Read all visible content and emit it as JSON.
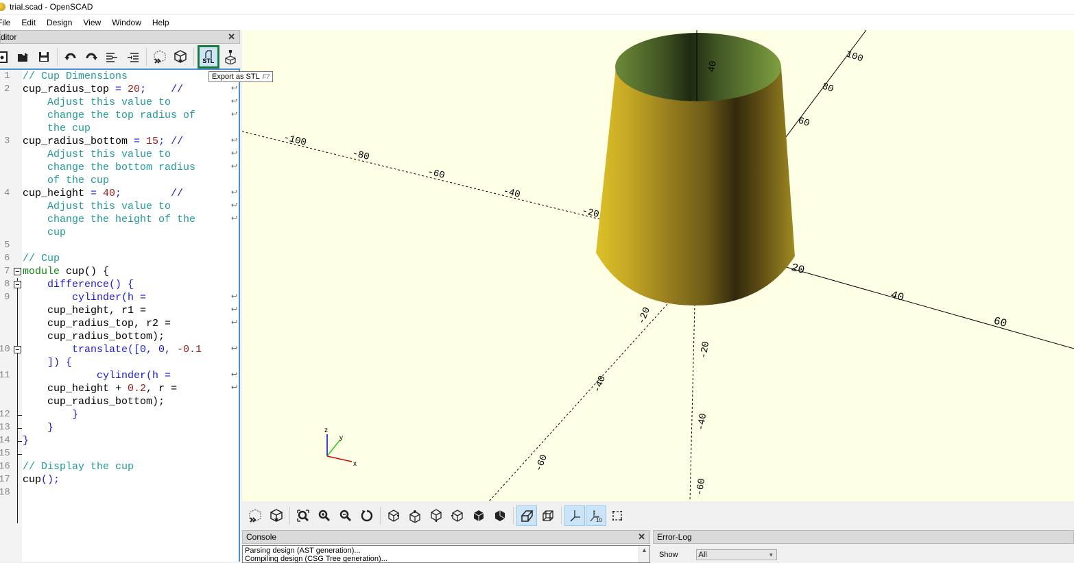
{
  "window": {
    "title": "trial.scad - OpenSCAD"
  },
  "menu": [
    "File",
    "Edit",
    "Design",
    "View",
    "Window",
    "Help"
  ],
  "editor": {
    "panel_title": "Editor",
    "toolbar": [
      {
        "name": "new-file-icon",
        "label": "New"
      },
      {
        "name": "open-file-icon",
        "label": "Open"
      },
      {
        "name": "save-icon",
        "label": "Save"
      },
      {
        "name": "undo-icon",
        "label": "Undo"
      },
      {
        "name": "redo-icon",
        "label": "Redo"
      },
      {
        "name": "unindent-icon",
        "label": "Unindent"
      },
      {
        "name": "indent-icon",
        "label": "Indent"
      },
      {
        "name": "preview-icon",
        "label": "Preview"
      },
      {
        "name": "render-icon",
        "label": "Render"
      },
      {
        "name": "export-stl-icon",
        "label": "Export as STL"
      },
      {
        "name": "send-to-print-icon",
        "label": "Send to 3D print"
      }
    ],
    "stl_label": "STL",
    "tooltip": {
      "text": "Export as STL",
      "shortcut": "F7"
    },
    "line_numbers": [
      "1",
      "2",
      "3",
      "4",
      "5",
      "6",
      "7",
      "8",
      "9",
      "10",
      "11",
      "12",
      "13",
      "14",
      "15",
      "16",
      "17",
      "18"
    ],
    "code": {
      "l1": "// Cup Dimensions",
      "l2a": "cup_radius_top",
      "l2b": " = ",
      "l2c": "20",
      "l2d": ";    //",
      "l2w1": "    Adjust this value to",
      "l2w2": "    change the top radius of",
      "l2w3": "    the cup",
      "l3a": "cup_radius_bottom",
      "l3b": " = ",
      "l3c": "15",
      "l3d": "; //",
      "l3w1": "    Adjust this value to",
      "l3w2": "    change the bottom radius",
      "l3w3": "    of the cup",
      "l4a": "cup_height",
      "l4b": " = ",
      "l4c": "40",
      "l4d": ";        //",
      "l4w1": "    Adjust this value to",
      "l4w2": "    change the height of the",
      "l4w3": "    cup",
      "l6": "// Cup",
      "l7a": "module",
      "l7b": " cup() {",
      "l8": "    difference() {",
      "l9a": "        cylinder(h =",
      "l9w1": "    cup_height, r1 =",
      "l9w2": "    cup_radius_top, r2 =",
      "l9w3": "    cup_radius_bottom);",
      "l10a": "        translate([0, 0, ",
      "l10b": "-0.1",
      "l10w1": "    ]) {",
      "l11a": "            cylinder(h =",
      "l11w1a": "    cup_height + ",
      "l11w1b": "0.2",
      "l11w1c": ", r =",
      "l11w2": "    cup_radius_bottom);",
      "l12": "        }",
      "l13": "    }",
      "l14": "}",
      "l16": "// Display the cup",
      "l17a": "cup",
      "l17b": "();"
    },
    "wrap_symbol": "↩"
  },
  "viewport": {
    "background": "#ffffe5",
    "model_color": "#d8bc2a",
    "axis_labels": {
      "x_pos": [
        "20",
        "40",
        "60"
      ],
      "x_neg": [
        "-100",
        "-80",
        "-60",
        "-40",
        "-20"
      ],
      "y_pos": [
        "60",
        "80",
        "100"
      ],
      "y_neg": [
        "-20",
        "-40",
        "-60"
      ],
      "z_pos": [
        "40"
      ],
      "z_neg": [
        "-20",
        "-40",
        "-60"
      ]
    },
    "gizmo": {
      "x": "x",
      "y": "y",
      "z": "z"
    }
  },
  "view_toolbar": [
    {
      "name": "preview-icon",
      "active": false
    },
    {
      "name": "render-icon",
      "active": false
    },
    {
      "name": "view-all-icon",
      "active": false
    },
    {
      "name": "zoom-in-icon",
      "active": false
    },
    {
      "name": "zoom-out-icon",
      "active": false
    },
    {
      "name": "reset-view-icon",
      "active": false
    },
    {
      "name": "view-right-icon",
      "active": false
    },
    {
      "name": "view-top-icon",
      "active": false
    },
    {
      "name": "view-bottom-icon",
      "active": false
    },
    {
      "name": "view-left-icon",
      "active": false
    },
    {
      "name": "view-front-icon",
      "active": false
    },
    {
      "name": "view-back-icon",
      "active": false
    },
    {
      "name": "perspective-icon",
      "active": true
    },
    {
      "name": "orthogonal-icon",
      "active": false
    },
    {
      "name": "show-axes-icon",
      "active": true
    },
    {
      "name": "show-scale-markers-icon",
      "active": true
    },
    {
      "name": "show-edges-icon",
      "active": false
    }
  ],
  "console": {
    "title": "Console",
    "lines": [
      "Parsing design (AST generation)...",
      "Compiling design (CSG Tree generation)..."
    ]
  },
  "error_log": {
    "title": "Error-Log",
    "show_label": "Show",
    "show_value": "All"
  }
}
